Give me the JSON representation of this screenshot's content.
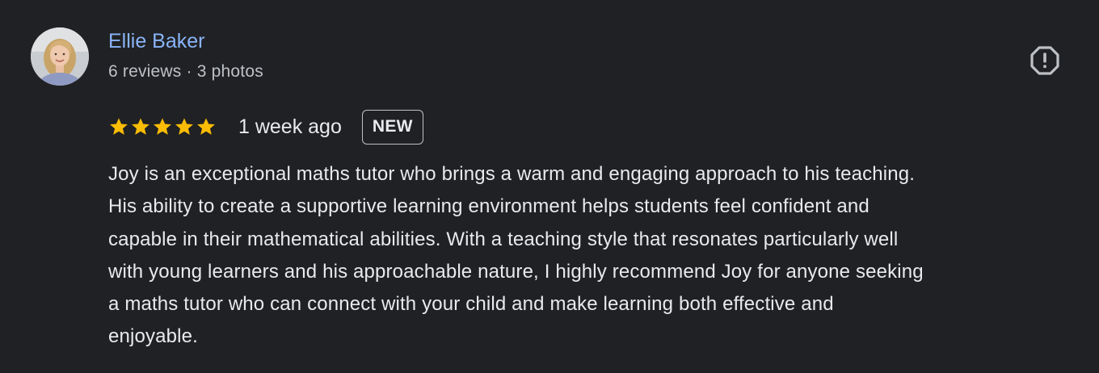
{
  "author": {
    "name": "Ellie Baker",
    "meta": "6 reviews · 3 photos"
  },
  "review": {
    "rating": 5,
    "rating_max": 5,
    "time": "1 week ago",
    "badge": "NEW",
    "text_lines": [
      "Joy is an exceptional maths tutor who brings a warm and engaging approach to his teaching.",
      "His ability to create a supportive learning environment helps students feel confident and",
      "capable in their mathematical abilities. With a teaching style that resonates particularly well",
      "with young learners and his approachable nature, I highly recommend Joy for anyone seeking",
      "a maths tutor who can connect with your child and make learning both effective and",
      "enjoyable."
    ]
  },
  "icons": {
    "report": "report-icon",
    "star": "star-icon",
    "avatar": "avatar-photo"
  },
  "colors": {
    "background": "#202124",
    "name_link": "#8ab4f8",
    "star": "#fbbc04",
    "text": "#e8eaed",
    "muted": "#bdc1c6"
  }
}
